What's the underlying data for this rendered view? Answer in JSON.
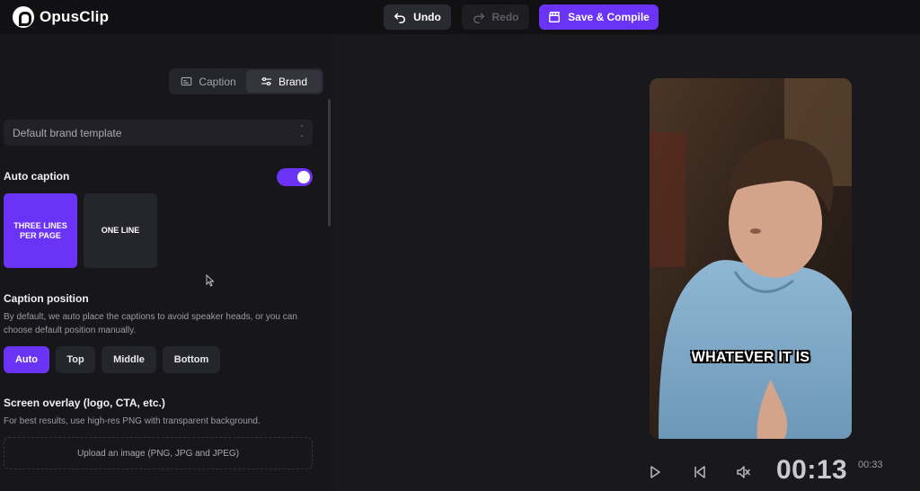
{
  "app": {
    "name": "OpusClip"
  },
  "toolbar": {
    "undo_label": "Undo",
    "redo_label": "Redo",
    "save_label": "Save & Compile"
  },
  "panel": {
    "tabs": [
      {
        "label": "Caption",
        "icon": "caption-icon",
        "active": false
      },
      {
        "label": "Brand",
        "icon": "sliders-icon",
        "active": true
      }
    ],
    "template_select": {
      "value": "Default brand template"
    },
    "auto_caption": {
      "label": "Auto caption",
      "enabled": true
    },
    "caption_styles": [
      {
        "label": "THREE LINES PER PAGE",
        "selected": true
      },
      {
        "label": "ONE LINE",
        "selected": false
      }
    ],
    "caption_position": {
      "label": "Caption position",
      "description": "By default, we auto place the captions to avoid speaker heads, or you can choose default position manually.",
      "options": [
        {
          "label": "Auto",
          "selected": true
        },
        {
          "label": "Top",
          "selected": false
        },
        {
          "label": "Middle",
          "selected": false
        },
        {
          "label": "Bottom",
          "selected": false
        }
      ]
    },
    "screen_overlay": {
      "label": "Screen overlay (logo, CTA, etc.)",
      "description": "For best results, use high-res PNG with transparent background.",
      "upload_label": "Upload an image (PNG, JPG and JPEG)"
    }
  },
  "preview": {
    "caption_text": "WHATEVER IT IS",
    "current_time": "00:13",
    "total_time": "00:33"
  },
  "colors": {
    "accent": "#6a33f5",
    "background": "#18181d",
    "panel": "#17171b"
  }
}
